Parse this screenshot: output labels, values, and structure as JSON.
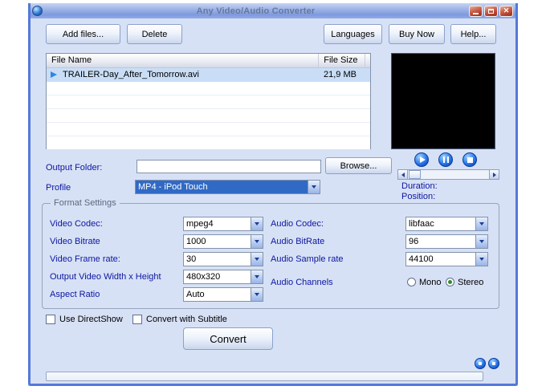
{
  "window": {
    "title": "Any Video/Audio Converter"
  },
  "toolbar": {
    "add_files": "Add files...",
    "delete_btn": "Delete",
    "languages": "Languages",
    "buy_now": "Buy Now",
    "help": "Help..."
  },
  "file_list": {
    "columns": [
      "File Name",
      "File Size"
    ],
    "rows": [
      {
        "name": "TRAILER-Day_After_Tomorrow.avi",
        "size": "21,9 MB"
      }
    ]
  },
  "output_folder": {
    "label": "Output Folder:",
    "value": "",
    "browse": "Browse..."
  },
  "profile": {
    "label": "Profile",
    "value": "MP4 - iPod Touch"
  },
  "media_info": {
    "duration_label": "Duration:",
    "position_label": "Position:"
  },
  "format_settings": {
    "title": "Format Settings",
    "video_codec_label": "Video Codec:",
    "video_codec_value": "mpeg4",
    "video_bitrate_label": "Video Bitrate",
    "video_bitrate_value": "1000",
    "video_framerate_label": "Video Frame rate:",
    "video_framerate_value": "30",
    "output_size_label": "Output Video Width x Height",
    "output_size_value": "480x320",
    "aspect_ratio_label": "Aspect Ratio",
    "aspect_ratio_value": "Auto",
    "audio_codec_label": "Audio Codec:",
    "audio_codec_value": "libfaac",
    "audio_bitrate_label": "Audio BitRate",
    "audio_bitrate_value": "96",
    "audio_samplerate_label": "Audio Sample rate",
    "audio_samplerate_value": "44100",
    "audio_channels_label": "Audio Channels",
    "mono_label": "Mono",
    "stereo_label": "Stereo"
  },
  "options": {
    "use_directshow": "Use DirectShow",
    "convert_with_subtitle": "Convert with Subtitle"
  },
  "actions": {
    "convert": "Convert"
  },
  "colors": {
    "selection": "#316ac5",
    "label_blue": "#0d16a0",
    "titlebar_text": "#68789c"
  }
}
